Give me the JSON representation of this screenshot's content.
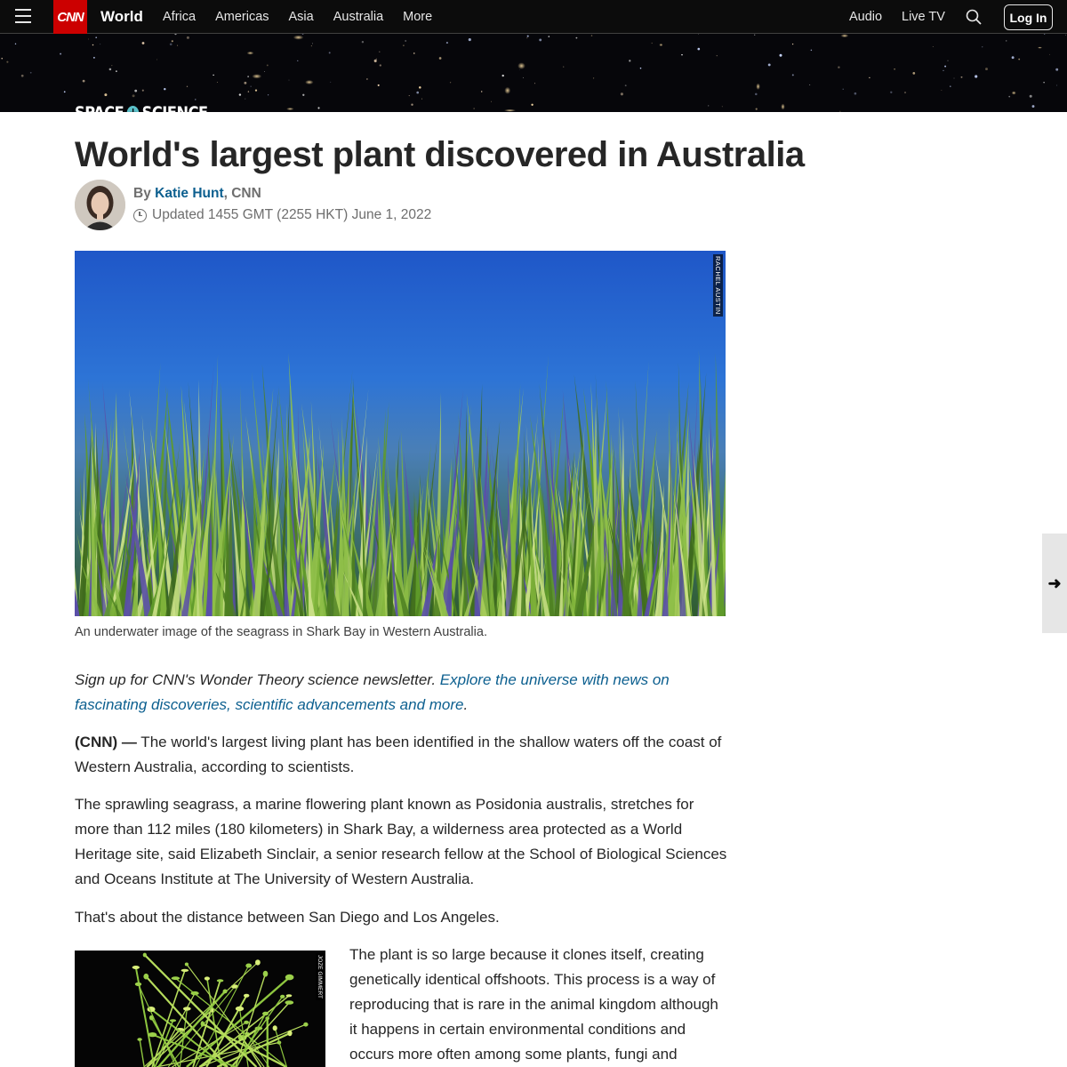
{
  "nav": {
    "logo": "CNN",
    "section": "World",
    "links": [
      "Africa",
      "Americas",
      "Asia",
      "Australia",
      "More"
    ],
    "audio": "Audio",
    "live_tv": "Live TV",
    "login": "Log In"
  },
  "banner": {
    "logo_left": "SPACE",
    "logo_plus": "+",
    "logo_right": "SCIENCE"
  },
  "article": {
    "headline": "World's largest plant discovered in Australia",
    "byline_prefix": "By ",
    "author": "Katie Hunt",
    "byline_suffix": ", CNN",
    "updated": "Updated 1455 GMT (2255 HKT) June 1, 2022",
    "hero_credit": "RACHEL AUSTIN",
    "hero_caption": "An underwater image of the seagrass in Shark Bay in Western Australia.",
    "newsletter_text": "Sign up for CNN's Wonder Theory science newsletter. ",
    "newsletter_link": "Explore the universe with news on fascinating discoveries, scientific advancements and more",
    "newsletter_end": ".",
    "p1_source": "(CNN) —",
    "p1": " The world's largest living plant has been identified in the shallow waters off the coast of Western Australia, according to scientists.",
    "p2": "The sprawling seagrass, a marine flowering plant known as Posidonia australis, stretches for more than 112 miles (180 kilometers) in Shark Bay, a wilderness area protected as a World Heritage site, said Elizabeth Sinclair, a senior research fellow at the School of Biological Sciences and Oceans Institute at The University of Western Australia.",
    "p3": "That's about the distance between San Diego and Los Angeles.",
    "inline_credit": "JOZE GIMMERT",
    "p4": "The plant is so large because it clones itself, creating genetically identical offshoots. This process is a way of reproducing that is rare in the animal kingdom although it happens in certain environmental conditions and occurs more often among some plants, fungi and"
  },
  "icons": {
    "menu": "hamburger-menu-icon",
    "search": "search-icon",
    "clock": "clock-icon",
    "next": "arrow-right-icon"
  },
  "colors": {
    "nav_bg": "#0c0c0c",
    "brand_red": "#cc0000",
    "link_blue": "#0c5f8f",
    "science_teal": "#5bc0c9"
  }
}
